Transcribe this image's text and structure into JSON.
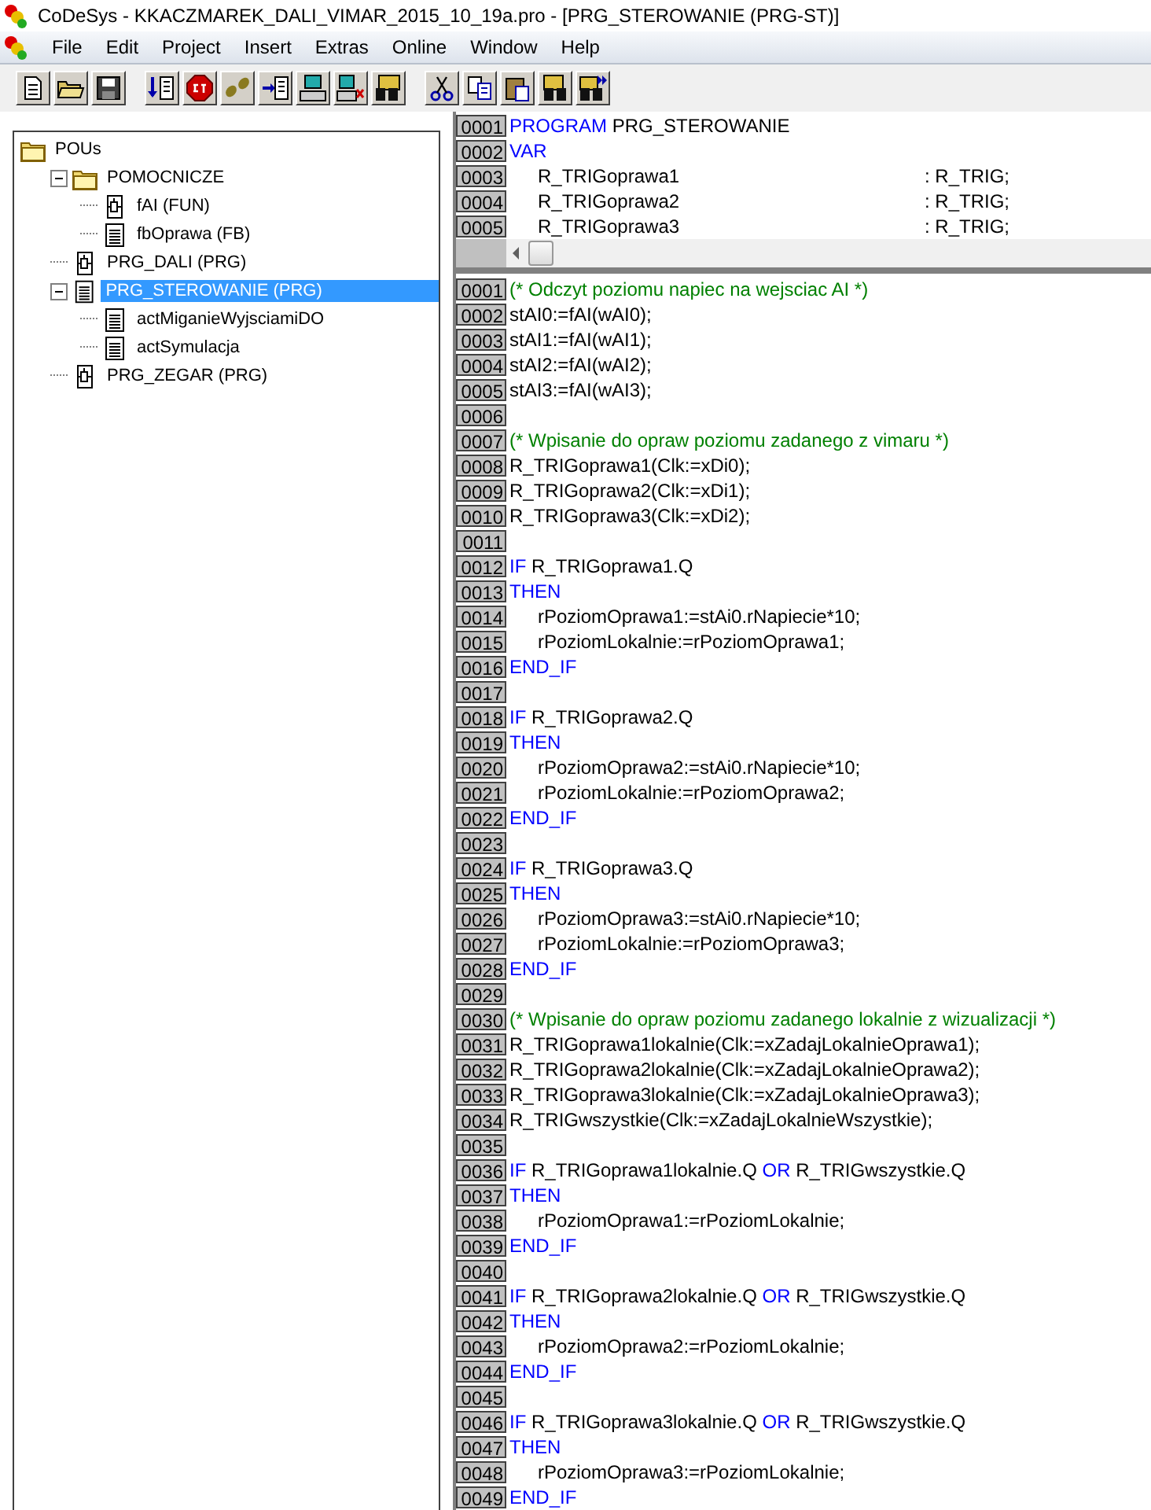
{
  "window": {
    "title": "CoDeSys - KKACZMAREK_DALI_VIMAR_2015_10_19a.pro - [PRG_STEROWANIE (PRG-ST)]"
  },
  "menu": [
    "File",
    "Edit",
    "Project",
    "Insert",
    "Extras",
    "Online",
    "Window",
    "Help"
  ],
  "tree": [
    {
      "label": "POUs",
      "kind": "folder",
      "selected": false,
      "children": [
        {
          "label": "POMOCNICZE",
          "kind": "folder",
          "expanded": true,
          "selected": false,
          "children": [
            {
              "label": "fAI (FUN)",
              "kind": "block",
              "selected": false
            },
            {
              "label": "fbOprawa (FB)",
              "kind": "document",
              "selected": false
            }
          ]
        },
        {
          "label": "PRG_DALI (PRG)",
          "kind": "block",
          "selected": false
        },
        {
          "label": "PRG_STEROWANIE (PRG)",
          "kind": "document",
          "expanded": true,
          "selected": true,
          "children": [
            {
              "label": "actMiganieWyjsciamiDO",
              "kind": "document",
              "selected": false
            },
            {
              "label": "actSymulacja",
              "kind": "document",
              "selected": false
            }
          ]
        },
        {
          "label": "PRG_ZEGAR (PRG)",
          "kind": "block",
          "selected": false
        }
      ]
    }
  ],
  "declarations": [
    {
      "number": "0001",
      "segments": [
        {
          "kind": "keyword",
          "text": "PROGRAM"
        },
        {
          "kind": "plain",
          "text": " PRG_STEROWANIE"
        }
      ]
    },
    {
      "number": "0002",
      "segments": [
        {
          "kind": "keyword",
          "text": "VAR"
        }
      ]
    },
    {
      "number": "0003",
      "name": "R_TRIGoprawa1",
      "type": ": R_TRIG;"
    },
    {
      "number": "0004",
      "name": "R_TRIGoprawa2",
      "type": ": R_TRIG;"
    },
    {
      "number": "0005",
      "name": "R_TRIGoprawa3",
      "type": ": R_TRIG;"
    }
  ],
  "body": [
    {
      "number": "0001",
      "segments": [
        {
          "kind": "comment",
          "text": "(* Odczyt poziomu napiec na wejsciac AI *)"
        }
      ]
    },
    {
      "number": "0002",
      "segments": [
        {
          "kind": "plain",
          "text": "stAI0:=fAI(wAI0);"
        }
      ]
    },
    {
      "number": "0003",
      "segments": [
        {
          "kind": "plain",
          "text": "stAI1:=fAI(wAI1);"
        }
      ]
    },
    {
      "number": "0004",
      "segments": [
        {
          "kind": "plain",
          "text": "stAI2:=fAI(wAI2);"
        }
      ]
    },
    {
      "number": "0005",
      "segments": [
        {
          "kind": "plain",
          "text": "stAI3:=fAI(wAI3);"
        }
      ]
    },
    {
      "number": "0006"
    },
    {
      "number": "0007",
      "segments": [
        {
          "kind": "comment",
          "text": "(* Wpisanie do opraw poziomu zadanego z vimaru *)"
        }
      ]
    },
    {
      "number": "0008",
      "segments": [
        {
          "kind": "plain",
          "text": "R_TRIGoprawa1(Clk:=xDi0);"
        }
      ]
    },
    {
      "number": "0009",
      "segments": [
        {
          "kind": "plain",
          "text": "R_TRIGoprawa2(Clk:=xDi1);"
        }
      ]
    },
    {
      "number": "0010",
      "segments": [
        {
          "kind": "plain",
          "text": "R_TRIGoprawa3(Clk:=xDi2);"
        }
      ]
    },
    {
      "number": "0011"
    },
    {
      "number": "0012",
      "segments": [
        {
          "kind": "keyword",
          "text": "IF"
        },
        {
          "kind": "plain",
          "text": " R_TRIGoprawa1.Q"
        }
      ]
    },
    {
      "number": "0013",
      "segments": [
        {
          "kind": "keyword",
          "text": "THEN"
        }
      ]
    },
    {
      "number": "0014",
      "indented": true,
      "segments": [
        {
          "kind": "plain",
          "text": "rPoziomOprawa1:=stAi0.rNapiecie*10;"
        }
      ]
    },
    {
      "number": "0015",
      "indented": true,
      "segments": [
        {
          "kind": "plain",
          "text": "rPoziomLokalnie:=rPoziomOprawa1;"
        }
      ]
    },
    {
      "number": "0016",
      "segments": [
        {
          "kind": "keyword",
          "text": "END_IF"
        }
      ]
    },
    {
      "number": "0017"
    },
    {
      "number": "0018",
      "segments": [
        {
          "kind": "keyword",
          "text": "IF"
        },
        {
          "kind": "plain",
          "text": " R_TRIGoprawa2.Q"
        }
      ]
    },
    {
      "number": "0019",
      "segments": [
        {
          "kind": "keyword",
          "text": "THEN"
        }
      ]
    },
    {
      "number": "0020",
      "indented": true,
      "segments": [
        {
          "kind": "plain",
          "text": "rPoziomOprawa2:=stAi0.rNapiecie*10;"
        }
      ]
    },
    {
      "number": "0021",
      "indented": true,
      "segments": [
        {
          "kind": "plain",
          "text": "rPoziomLokalnie:=rPoziomOprawa2;"
        }
      ]
    },
    {
      "number": "0022",
      "segments": [
        {
          "kind": "keyword",
          "text": "END_IF"
        }
      ]
    },
    {
      "number": "0023"
    },
    {
      "number": "0024",
      "segments": [
        {
          "kind": "keyword",
          "text": "IF"
        },
        {
          "kind": "plain",
          "text": " R_TRIGoprawa3.Q"
        }
      ]
    },
    {
      "number": "0025",
      "segments": [
        {
          "kind": "keyword",
          "text": "THEN"
        }
      ]
    },
    {
      "number": "0026",
      "indented": true,
      "segments": [
        {
          "kind": "plain",
          "text": "rPoziomOprawa3:=stAi0.rNapiecie*10;"
        }
      ]
    },
    {
      "number": "0027",
      "indented": true,
      "segments": [
        {
          "kind": "plain",
          "text": "rPoziomLokalnie:=rPoziomOprawa3;"
        }
      ]
    },
    {
      "number": "0028",
      "segments": [
        {
          "kind": "keyword",
          "text": "END_IF"
        }
      ]
    },
    {
      "number": "0029"
    },
    {
      "number": "0030",
      "segments": [
        {
          "kind": "comment",
          "text": "(* Wpisanie do opraw poziomu zadanego lokalnie z wizualizacji *)"
        }
      ]
    },
    {
      "number": "0031",
      "segments": [
        {
          "kind": "plain",
          "text": "R_TRIGoprawa1lokalnie(Clk:=xZadajLokalnieOprawa1);"
        }
      ]
    },
    {
      "number": "0032",
      "segments": [
        {
          "kind": "plain",
          "text": "R_TRIGoprawa2lokalnie(Clk:=xZadajLokalnieOprawa2);"
        }
      ]
    },
    {
      "number": "0033",
      "segments": [
        {
          "kind": "plain",
          "text": "R_TRIGoprawa3lokalnie(Clk:=xZadajLokalnieOprawa3);"
        }
      ]
    },
    {
      "number": "0034",
      "segments": [
        {
          "kind": "plain",
          "text": "R_TRIGwszystkie(Clk:=xZadajLokalnieWszystkie);"
        }
      ]
    },
    {
      "number": "0035"
    },
    {
      "number": "0036",
      "segments": [
        {
          "kind": "keyword",
          "text": "IF"
        },
        {
          "kind": "plain",
          "text": " R_TRIGoprawa1lokalnie.Q "
        },
        {
          "kind": "keyword",
          "text": "OR"
        },
        {
          "kind": "plain",
          "text": " R_TRIGwszystkie.Q"
        }
      ]
    },
    {
      "number": "0037",
      "segments": [
        {
          "kind": "keyword",
          "text": "THEN"
        }
      ]
    },
    {
      "number": "0038",
      "indented": true,
      "segments": [
        {
          "kind": "plain",
          "text": "rPoziomOprawa1:=rPoziomLokalnie;"
        }
      ]
    },
    {
      "number": "0039",
      "segments": [
        {
          "kind": "keyword",
          "text": "END_IF"
        }
      ]
    },
    {
      "number": "0040"
    },
    {
      "number": "0041",
      "segments": [
        {
          "kind": "keyword",
          "text": "IF"
        },
        {
          "kind": "plain",
          "text": " R_TRIGoprawa2lokalnie.Q "
        },
        {
          "kind": "keyword",
          "text": "OR"
        },
        {
          "kind": "plain",
          "text": " R_TRIGwszystkie.Q"
        }
      ]
    },
    {
      "number": "0042",
      "segments": [
        {
          "kind": "keyword",
          "text": "THEN"
        }
      ]
    },
    {
      "number": "0043",
      "indented": true,
      "segments": [
        {
          "kind": "plain",
          "text": "rPoziomOprawa2:=rPoziomLokalnie;"
        }
      ]
    },
    {
      "number": "0044",
      "segments": [
        {
          "kind": "keyword",
          "text": "END_IF"
        }
      ]
    },
    {
      "number": "0045"
    },
    {
      "number": "0046",
      "segments": [
        {
          "kind": "keyword",
          "text": "IF"
        },
        {
          "kind": "plain",
          "text": " R_TRIGoprawa3lokalnie.Q "
        },
        {
          "kind": "keyword",
          "text": "OR"
        },
        {
          "kind": "plain",
          "text": " R_TRIGwszystkie.Q"
        }
      ]
    },
    {
      "number": "0047",
      "segments": [
        {
          "kind": "keyword",
          "text": "THEN"
        }
      ]
    },
    {
      "number": "0048",
      "indented": true,
      "segments": [
        {
          "kind": "plain",
          "text": "rPoziomOprawa3:=rPoziomLokalnie;"
        }
      ]
    },
    {
      "number": "0049",
      "segments": [
        {
          "kind": "keyword",
          "text": "END_IF"
        }
      ]
    }
  ]
}
